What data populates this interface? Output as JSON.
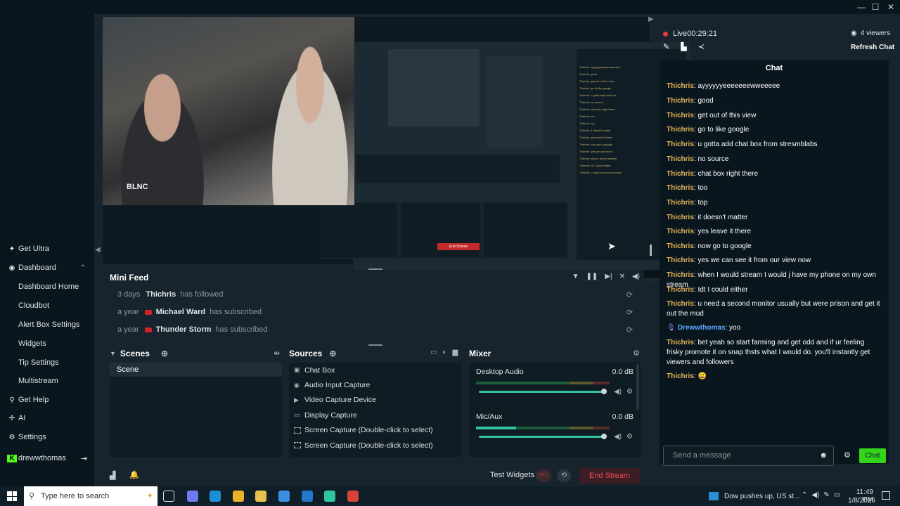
{
  "window": {
    "minimize": "—",
    "maximize": "☐",
    "close": "✕"
  },
  "sidebar": {
    "items": [
      {
        "icon": "lightbulb-icon",
        "glyph": "✦",
        "label": "Get Ultra",
        "sub": false
      },
      {
        "icon": "dashboard-icon",
        "glyph": "◉",
        "label": "Dashboard",
        "sub": false
      },
      {
        "icon": "",
        "glyph": "",
        "label": "Dashboard Home",
        "sub": true
      },
      {
        "icon": "",
        "glyph": "",
        "label": "Cloudbot",
        "sub": true
      },
      {
        "icon": "",
        "glyph": "",
        "label": "Alert Box Settings",
        "sub": true
      },
      {
        "icon": "",
        "glyph": "",
        "label": "Widgets",
        "sub": true
      },
      {
        "icon": "",
        "glyph": "",
        "label": "Tip Settings",
        "sub": true
      },
      {
        "icon": "",
        "glyph": "",
        "label": "Multistream",
        "sub": true
      },
      {
        "icon": "help-icon",
        "glyph": "⚲",
        "label": "Get Help",
        "sub": false
      },
      {
        "icon": "ai-icon",
        "glyph": "✢",
        "label": "AI",
        "sub": false
      },
      {
        "icon": "settings-icon",
        "glyph": "⚙",
        "label": "Settings",
        "sub": false
      },
      {
        "icon": "kick-icon",
        "glyph": "K",
        "label": "drewwthomas",
        "sub": false
      }
    ],
    "chevron": "⌃",
    "logout": "⇥"
  },
  "webcam": {
    "shirt_text": "BLNC"
  },
  "nested": {
    "chat_lines": [
      "Thichris: ayyyyyyeeeeeewweeee",
      "Thichris: good",
      "Thichris: get out of this view",
      "Thichris: go to like google",
      "Thichris: u gotta add chat box",
      "Thichris: no source",
      "Thichris: chat box right there",
      "Thichris: too",
      "Thichris: top",
      "Thichris: it doesn't matter",
      "Thichris: yes leave it there",
      "Thichris: now go to google",
      "Thichris: yes we can see it",
      "Thichris: when I would stream",
      "Thichris: Idt I could either",
      "Thichris: u need a second monitor"
    ],
    "end_label": "End Stream"
  },
  "minifeed": {
    "title": "Mini Feed",
    "rows": [
      {
        "time": "3 days",
        "user": "Thichris",
        "action": "has followed",
        "youtube": false
      },
      {
        "time": "a year",
        "user": "Michael Ward",
        "action": "has subscribed",
        "youtube": true
      },
      {
        "time": "a year",
        "user": "Thunder Storm",
        "action": "has subscribed",
        "youtube": true
      }
    ]
  },
  "scenes": {
    "title": "Scenes",
    "items": [
      "Scene"
    ]
  },
  "sources": {
    "title": "Sources",
    "items": [
      {
        "label": "Chat Box",
        "type": "chat"
      },
      {
        "label": "Audio Input Capture",
        "type": "audio"
      },
      {
        "label": "Video Capture Device",
        "type": "video"
      },
      {
        "label": "Display Capture",
        "type": "display"
      },
      {
        "label": "Screen Capture (Double-click to select)",
        "type": "screen"
      },
      {
        "label": "Screen Capture (Double-click to select)",
        "type": "screen"
      }
    ]
  },
  "mixer": {
    "title": "Mixer",
    "channels": [
      {
        "name": "Desktop Audio",
        "db": "0.0 dB",
        "level": 0,
        "volume": 1.0
      },
      {
        "name": "Mic/Aux",
        "db": "0.0 dB",
        "level": 0.3,
        "volume": 1.0
      }
    ]
  },
  "footer": {
    "test_widgets": "Test Widgets",
    "rec": "REC",
    "end_stream": "End Stream"
  },
  "live": {
    "status": "Live",
    "timer": "00:29:21",
    "viewers": "4 viewers",
    "refresh_chat": "Refresh Chat"
  },
  "chat": {
    "header": "Chat",
    "messages": [
      {
        "name": "Thichris",
        "text": ": ayyyyyyeeeeeeewweeeee",
        "mod": false
      },
      {
        "name": "Thichris",
        "text": ": good",
        "mod": false
      },
      {
        "name": "Thichris",
        "text": ": get out of this view",
        "mod": false
      },
      {
        "name": "Thichris",
        "text": ": go to like google",
        "mod": false
      },
      {
        "name": "Thichris",
        "text": ": u gotta add chat box from stresmblabs",
        "mod": false
      },
      {
        "name": "Thichris",
        "text": ": no source",
        "mod": false
      },
      {
        "name": "Thichris",
        "text": ": chat box right there",
        "mod": false
      },
      {
        "name": "Thichris",
        "text": ": too",
        "mod": false
      },
      {
        "name": "Thichris",
        "text": ": top",
        "mod": false
      },
      {
        "name": "Thichris",
        "text": ": it doesn't matter",
        "mod": false
      },
      {
        "name": "Thichris",
        "text": ": yes leave it there",
        "mod": false
      },
      {
        "name": "Thichris",
        "text": ": now go to google",
        "mod": false
      },
      {
        "name": "Thichris",
        "text": ": yes we can see it from our view now",
        "mod": false
      },
      {
        "name": "Thichris",
        "text": ": when I would stream I would j have my phone on my own stream",
        "mod": false
      },
      {
        "name": "Thichris",
        "text": ": Idt I could either",
        "mod": false
      },
      {
        "name": "Thichris",
        "text": ": u need a second monitor usually but were prison and get it out the mud",
        "mod": false
      },
      {
        "name": "Drewwthomas",
        "text": ": yoo",
        "mod": true
      },
      {
        "name": "Thichris",
        "text": ": bet yeah so start farming and get odd and if ur feeling frisky promote it on snap thsts what I would do. you'll instantly get viewers and followers",
        "mod": false
      },
      {
        "name": "Thichris",
        "text": ": 😀",
        "mod": false
      }
    ],
    "input_placeholder": "Send a message",
    "send_label": "Chat"
  },
  "taskbar": {
    "search_placeholder": "Type here to search",
    "news": "Dow pushes up, US st...",
    "time": "11:49 PM",
    "date": "1/8/2026",
    "apps": [
      {
        "name": "task-view-icon",
        "color": "#0f1e27"
      },
      {
        "name": "copilot-icon",
        "color": "#6b7cf0"
      },
      {
        "name": "edge-icon",
        "color": "#1a8fd6"
      },
      {
        "name": "chrome-icon",
        "color": "#e9b229"
      },
      {
        "name": "file-explorer-icon",
        "color": "#e8c04d"
      },
      {
        "name": "store-icon",
        "color": "#3a8fe0"
      },
      {
        "name": "mail-icon",
        "color": "#2277cc"
      },
      {
        "name": "streamlabs-icon",
        "color": "#31c3a2"
      },
      {
        "name": "chrome-active-icon",
        "color": "#d8433a"
      }
    ]
  }
}
